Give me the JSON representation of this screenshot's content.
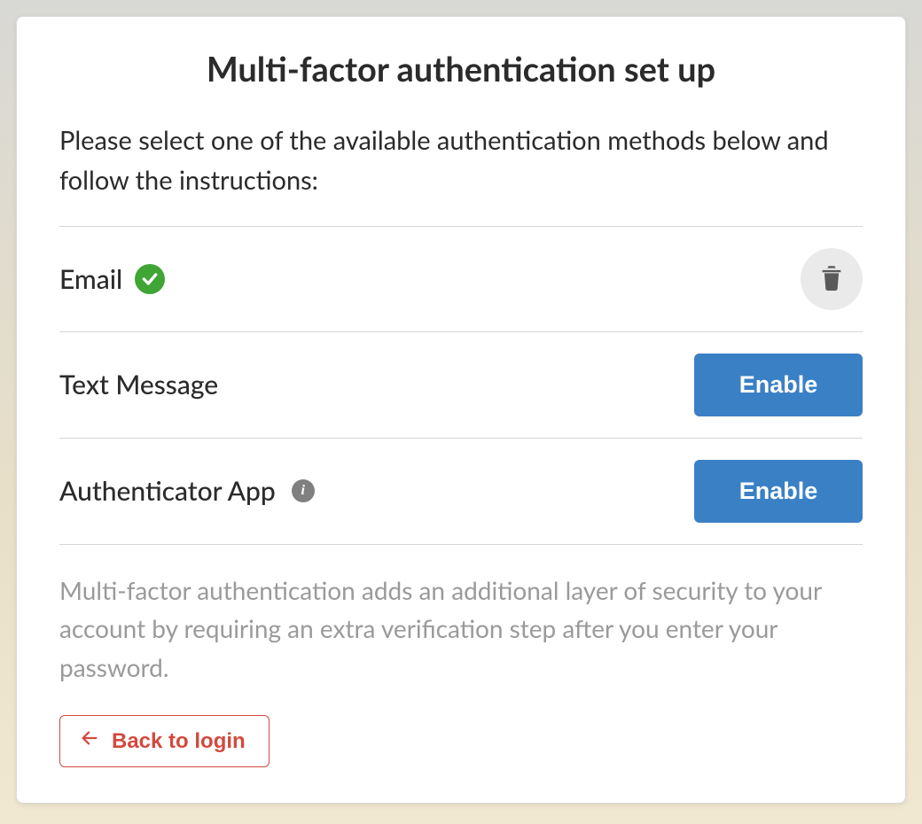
{
  "title": "Multi-factor authentication set up",
  "instructions": "Please select one of the available authentication methods below and follow the instructions:",
  "methods": {
    "email": {
      "label": "Email"
    },
    "text_message": {
      "label": "Text Message",
      "action_label": "Enable"
    },
    "authenticator": {
      "label": "Authenticator App",
      "action_label": "Enable"
    }
  },
  "description": "Multi-factor authentication adds an additional layer of security to your account by requiring an extra verification step after you enter your password.",
  "back_label": "Back to login"
}
